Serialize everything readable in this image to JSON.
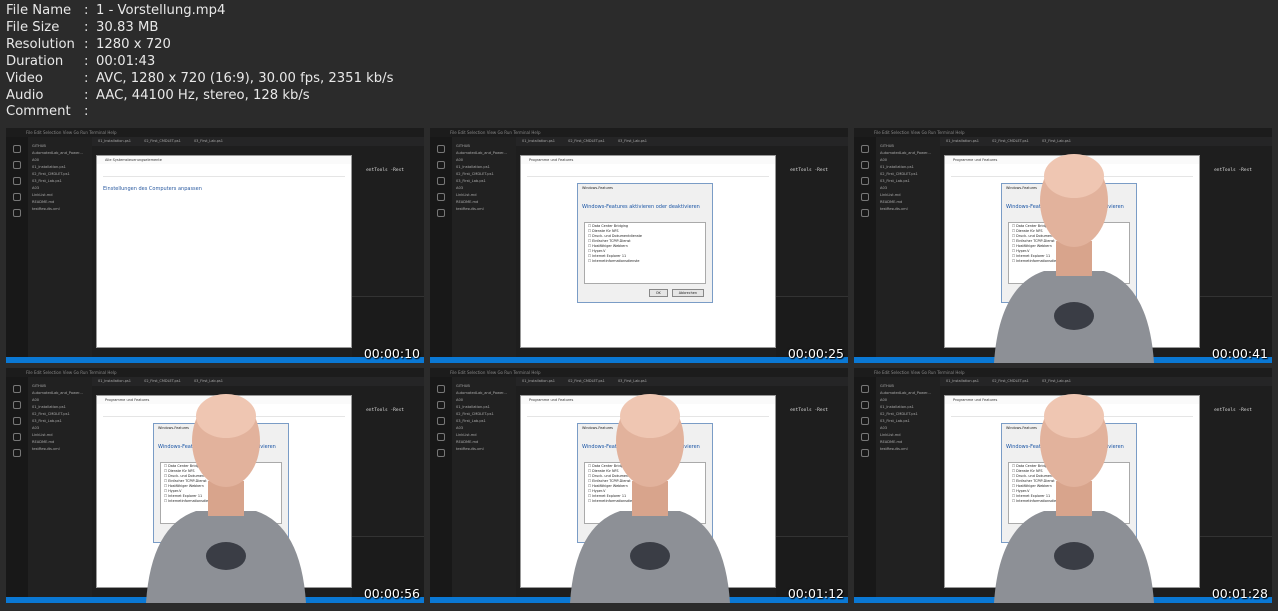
{
  "info": [
    {
      "label": "File Name",
      "value": "1 - Vorstellung.mp4"
    },
    {
      "label": "File Size",
      "value": "30.83 MB"
    },
    {
      "label": "Resolution",
      "value": "1280 x 720"
    },
    {
      "label": "Duration",
      "value": "00:01:43"
    },
    {
      "label": "Video",
      "value": "AVC, 1280 x 720 (16:9), 30.00 fps, 2351 kb/s"
    },
    {
      "label": "Audio",
      "value": "AAC, 44100 Hz, stereo, 128 kb/s"
    },
    {
      "label": "Comment",
      "value": ""
    }
  ],
  "separator": ":",
  "thumb_ui": {
    "menu": "File  Edit  Selection  View  Go  Run  Terminal  Help",
    "tabs": "01_Installation.ps1 02_First_CMDLET.ps1 03_First_Lab.ps1",
    "sidebar": [
      "GITHUB",
      "AutomatedLab_and_Power...",
      "A00",
      "01_Installation.ps1",
      "02_First_CMDLET.ps1",
      "03_First_Lab.ps1",
      "A03",
      "LinkList.md",
      "README.md",
      "testResults.xml"
    ],
    "code": "entTools -Rest",
    "window1_title": "Alle Systemsteuerungselemente",
    "window1_heading": "Einstellungen des Computers anpassen",
    "window2_title": "Programme und Features",
    "dialog_title": "Windows-Features",
    "dialog_heading": "Windows-Features aktivieren oder deaktivieren",
    "dialog_items": [
      "Data Center Bridging",
      "Dienste für NFS",
      "Druck- und Dokumentdienste",
      "Einfacher TCPIP-Dienst",
      "Hostfähiger Webkern",
      "Hyper-V",
      "Internet Explorer 11",
      "Internetinformationsdienste"
    ],
    "ok": "OK",
    "cancel": "Abbrechen"
  },
  "thumbnails": [
    {
      "time": "00:00:10",
      "scene": "control-panel",
      "person": false
    },
    {
      "time": "00:00:25",
      "scene": "features",
      "person": false
    },
    {
      "time": "00:00:41",
      "scene": "features",
      "person": true
    },
    {
      "time": "00:00:56",
      "scene": "features",
      "person": true
    },
    {
      "time": "00:01:12",
      "scene": "features",
      "person": true
    },
    {
      "time": "00:01:28",
      "scene": "features",
      "person": true
    }
  ]
}
